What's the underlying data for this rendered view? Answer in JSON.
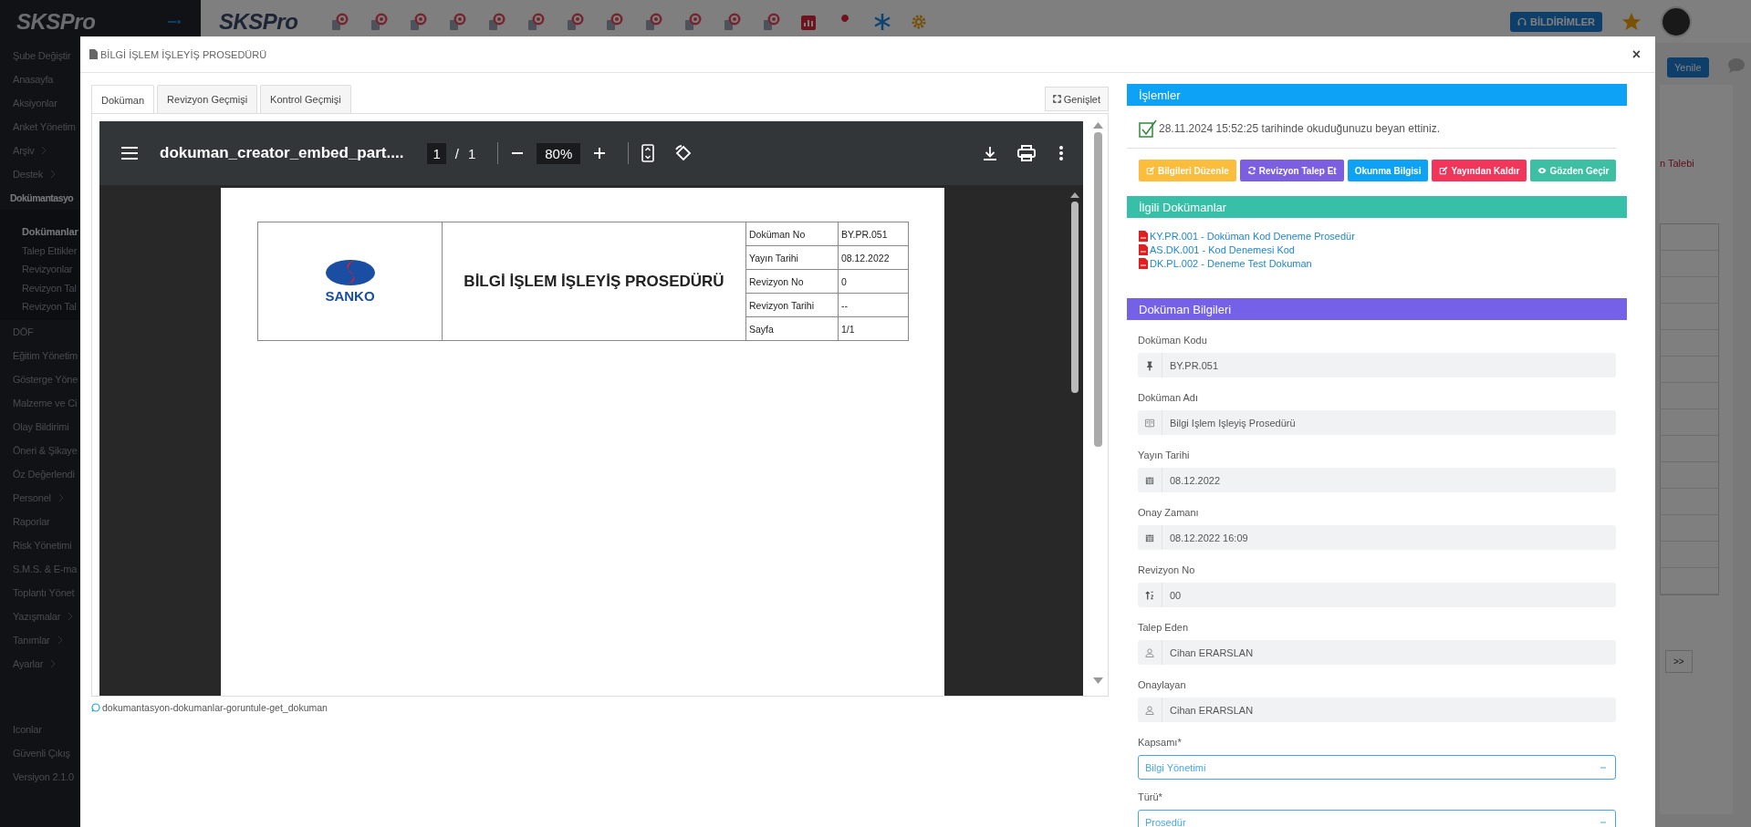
{
  "top_bar": {
    "sidebar_logo": "SKSPro",
    "app_logo": "SKSPro",
    "notifications_button": "BİLDİRİMLER"
  },
  "sidebar": {
    "items": [
      {
        "label": "Şube Değiştir",
        "selected": false
      },
      {
        "label": "Anasayfa",
        "selected": false
      },
      {
        "label": "Aksiyonlar",
        "selected": false
      },
      {
        "label": "Anket Yönetim",
        "selected": false
      },
      {
        "label": "Arşiv",
        "chevron": true,
        "selected": false
      },
      {
        "label": "Destek",
        "chevron": true,
        "selected": false
      },
      {
        "label": "Dokümantasyo",
        "selected": true,
        "children": [
          {
            "label": "Dokümanlar",
            "selected": true
          },
          {
            "label": "Talep Ettikler",
            "selected": false
          },
          {
            "label": "Revizyonlar",
            "selected": false
          },
          {
            "label": "Revizyon Tal",
            "selected": false
          },
          {
            "label": "Revizyon Tal",
            "selected": false
          }
        ]
      },
      {
        "label": "DÖF",
        "selected": false
      },
      {
        "label": "Eğitim Yönetim",
        "selected": false
      },
      {
        "label": "Gösterge Yöne",
        "selected": false
      },
      {
        "label": "Malzeme ve Ci",
        "selected": false
      },
      {
        "label": "Olay Bildirimi",
        "selected": false
      },
      {
        "label": "Öneri & Şikaye",
        "selected": false
      },
      {
        "label": "Öz Değerlendi",
        "selected": false
      },
      {
        "label": "Personel",
        "chevron": true,
        "selected": false
      },
      {
        "label": "Raporlar",
        "selected": false
      },
      {
        "label": "Risk Yönetimi",
        "selected": false
      },
      {
        "label": "S.M.S. & E-ma",
        "selected": false
      },
      {
        "label": "Toplantı Yönet",
        "selected": false
      },
      {
        "label": "Yazışmalar",
        "chevron": true,
        "selected": false
      },
      {
        "label": "Tanımlar",
        "chevron": true,
        "selected": false
      },
      {
        "label": "Ayarlar",
        "chevron": true,
        "selected": false
      }
    ],
    "footer": [
      "Iconlar",
      "Güvenli Çıkış",
      "Versiyon 2.1.0"
    ]
  },
  "background": {
    "refresh_button": "Yenile",
    "text_fragment": "n Talebi",
    "pager_button": ">>"
  },
  "modal": {
    "title": "BİLGİ İŞLEM İŞLEYİŞ PROSEDÜRÜ",
    "close": "×",
    "tabs": [
      {
        "label": "Doküman",
        "selected": true
      },
      {
        "label": "Revizyon Geçmişi",
        "selected": false
      },
      {
        "label": "Kontrol Geçmişi",
        "selected": false
      }
    ],
    "expand_button": "Genişlet",
    "pdf_viewer": {
      "file_name": "dokuman_creator_embed_part....",
      "page": "1",
      "page_separator": "/",
      "page_count": "1",
      "zoom": "80%",
      "document": {
        "logo_text": "SANKO",
        "title": "BİLGİ İŞLEM İŞLEYİŞ PROSEDÜRÜ",
        "rows": [
          {
            "label": "Doküman No",
            "value": "BY.PR.051"
          },
          {
            "label": "Yayın Tarihi",
            "value": "08.12.2022"
          },
          {
            "label": "Revizyon No",
            "value": "0"
          },
          {
            "label": "Revizyon Tarihi",
            "value": "--"
          },
          {
            "label": "Sayfa",
            "value": "1/1"
          }
        ]
      }
    },
    "link": "dokumantasyon-dokumanlar-goruntule-get_dokuman",
    "actions": {
      "title": "İşlemler",
      "read_notice": "28.11.2024 15:52:25 tarihinde okuduğunuzu beyan ettiniz.",
      "buttons": [
        {
          "label": "Bilgileri Düzenle",
          "color": "#fbbd3b"
        },
        {
          "label": "Revizyon Talep Et",
          "color": "#7b5fe0"
        },
        {
          "label": "Okunma Bilgisi",
          "color": "#0ea2f6"
        },
        {
          "label": "Yayından Kaldır",
          "color": "#f2365b"
        },
        {
          "label": "Gözden Geçir",
          "color": "#3cbfa3"
        }
      ]
    },
    "related": {
      "title": "İlgili Dokümanlar",
      "items": [
        "KY.PR.001 - Doküman Kod Deneme Prosedür",
        "AS.DK.001 - Kod Denemesi Kod",
        "DK.PL.002 - Deneme Test Dokuman"
      ]
    },
    "info": {
      "title": "Doküman Bilgileri",
      "fields": [
        {
          "kind": "text",
          "label": "Doküman Kodu",
          "value": "BY.PR.051"
        },
        {
          "kind": "text",
          "label": "Doküman Adı",
          "value": "Bilgi Işlem Işleyiş Prosedürü"
        },
        {
          "kind": "text",
          "label": "Yayın Tarihi",
          "value": "08.12.2022"
        },
        {
          "kind": "text",
          "label": "Onay Zamanı",
          "value": "08.12.2022 16:09"
        },
        {
          "kind": "text",
          "label": "Revizyon No",
          "value": "00"
        },
        {
          "kind": "text",
          "label": "Talep Eden",
          "value": "Cihan ERARSLAN"
        },
        {
          "kind": "text",
          "label": "Onaylayan",
          "value": "Cihan ERARSLAN"
        },
        {
          "kind": "select",
          "label": "Kapsamı*",
          "value": "Bilgi Yönetimi"
        },
        {
          "kind": "select",
          "label": "Türü*",
          "value": "Prosedür"
        }
      ]
    }
  }
}
